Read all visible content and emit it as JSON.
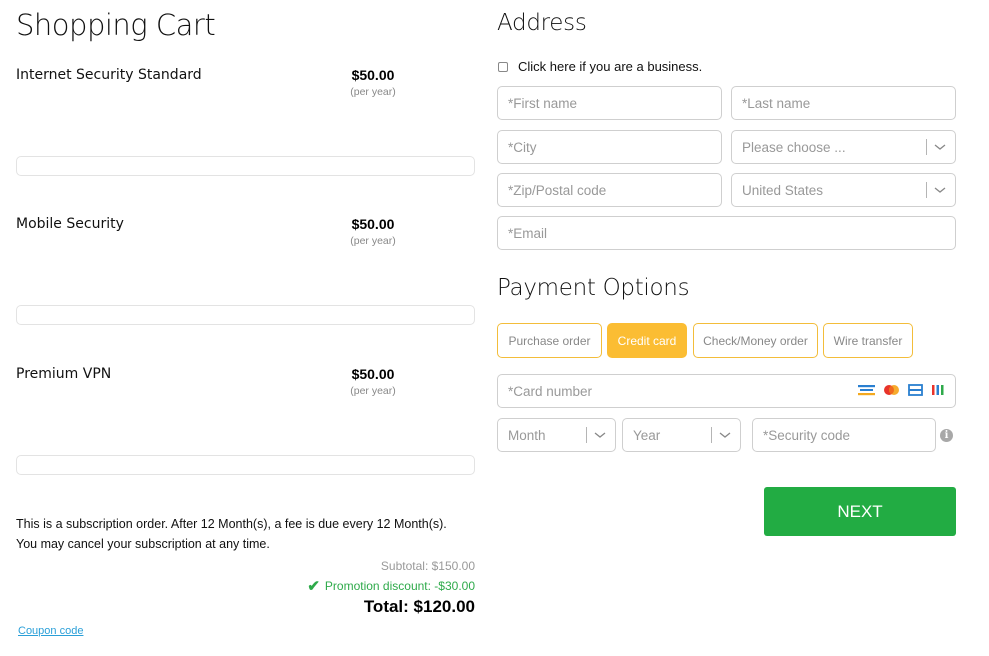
{
  "cart": {
    "title": "Shopping Cart",
    "items": [
      {
        "name": "Internet Security Standard",
        "price": "$50.00",
        "period": "(per year)"
      },
      {
        "name": "Mobile Security",
        "price": "$50.00",
        "period": "(per year)"
      },
      {
        "name": "Premium VPN",
        "price": "$50.00",
        "period": "(per year)"
      }
    ],
    "subscription_note_line1": "This is a subscription order. After 12 Month(s), a fee is due every 12 Month(s).",
    "subscription_note_line2": "You may cancel your subscription at any time.",
    "subtotal": "Subtotal:  $150.00",
    "promotion": "Promotion discount: -$30.00",
    "total": "Total: $120.00",
    "coupon_link": "Coupon code"
  },
  "address": {
    "title": "Address",
    "business_checkbox_label": "Click here if you are a business.",
    "business_checked": false,
    "first_name_placeholder": "*First name",
    "last_name_placeholder": "*Last name",
    "city_placeholder": "*City",
    "state_select": "Please choose ...",
    "zip_placeholder": "*Zip/Postal code",
    "country_select": "United States",
    "email_placeholder": "*Email"
  },
  "payment": {
    "title": "Payment Options",
    "options": [
      {
        "label": "Purchase order",
        "active": false
      },
      {
        "label": "Credit card",
        "active": true
      },
      {
        "label": "Check/Money order",
        "active": false
      },
      {
        "label": "Wire transfer",
        "active": false
      }
    ],
    "card_number_placeholder": "*Card number",
    "card_icons": [
      "amex-icon",
      "mastercard-icon",
      "visa-icon",
      "discover-icon"
    ],
    "month_select": "Month",
    "year_select": "Year",
    "security_code_placeholder": "*Security code",
    "info_glyph": "i",
    "next_label": "NEXT"
  },
  "colors": {
    "accent_yellow": "#fbbd33",
    "next_green": "#22ac43",
    "promo_green": "#2eaa4a",
    "link_blue": "#2a9fd8"
  }
}
